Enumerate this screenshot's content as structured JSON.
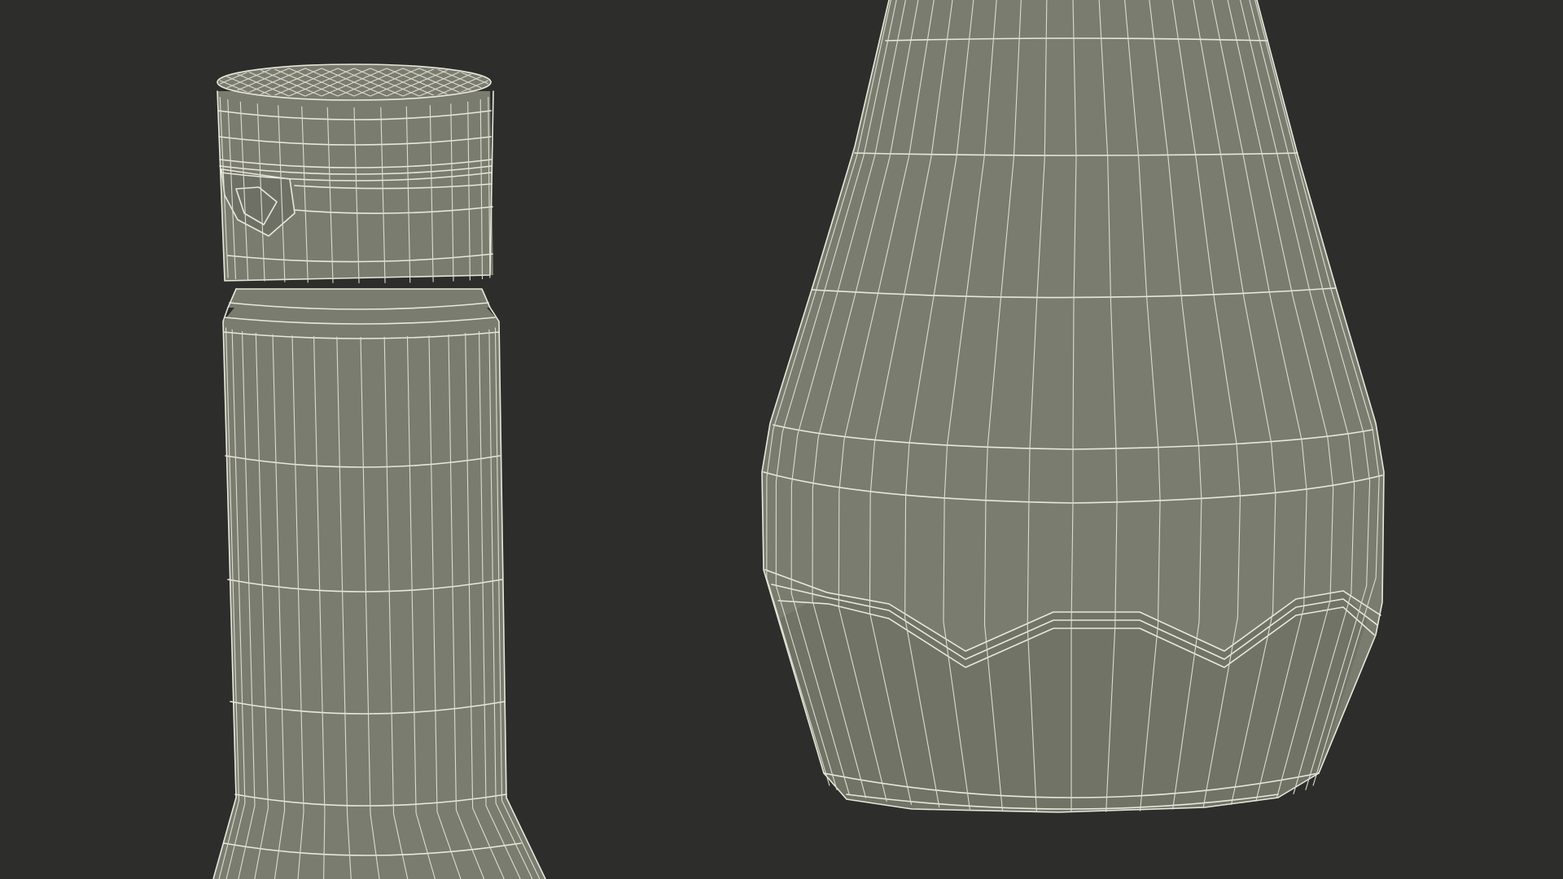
{
  "scene": {
    "background_color": "#2d2d2b",
    "surface_color": "#7b7c70",
    "wire_color": "#e8e8dc",
    "objects": [
      {
        "name": "bottle-neck-with-cap",
        "shading": "wireframe-on-shaded"
      },
      {
        "name": "bottle-body-lower",
        "shading": "wireframe-on-shaded"
      }
    ]
  }
}
